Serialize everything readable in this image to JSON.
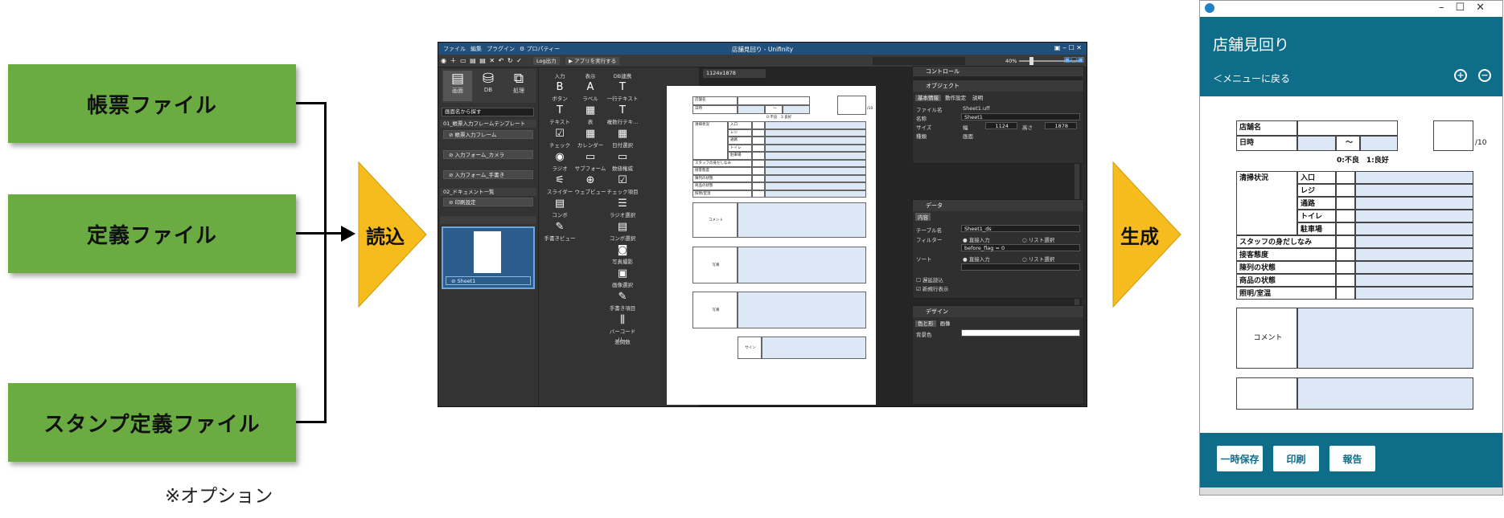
{
  "sources": [
    {
      "label": "帳票ファイル"
    },
    {
      "label": "定義ファイル"
    },
    {
      "label": "スタンプ定義ファイル"
    }
  ],
  "note": "※オプション",
  "arrows": {
    "read": "読込",
    "generate": "生成",
    "arrow_color": "#f6bc1e",
    "box_color": "#6aac42"
  },
  "editor": {
    "menu": [
      "ファイル",
      "編集",
      "プラグイン",
      "⚙ プロパティー"
    ],
    "title": "店舗見回り - Unifinity",
    "toolbar": {
      "log": "Log出力",
      "run": "▶ アプリを実行する",
      "zoom": "40%"
    },
    "nav_tabs": [
      "画面",
      "DB",
      "処理"
    ],
    "search_placeholder": "画面名から探す",
    "groups": [
      {
        "title": "01_帳票入力フレームテンプレート",
        "items": [
          "⊘ 帳票入力フレーム",
          "⊘ 入力フォーム_カメラ",
          "⊘ 入力フォーム_手書き"
        ]
      },
      {
        "title": "02_ドキュメント一覧",
        "items": [
          "⊘ 印刷設定"
        ]
      }
    ],
    "sheet_label": "⊘ Sheet1",
    "tool_columns": [
      {
        "title": "入力",
        "tools": [
          {
            "glyph": "B",
            "label": "ボタン"
          },
          {
            "glyph": "T",
            "label": "テキスト"
          },
          {
            "glyph": "☑",
            "label": "チェック"
          },
          {
            "glyph": "◉",
            "label": "ラジオ"
          },
          {
            "glyph": "⚟",
            "label": "スライダー"
          },
          {
            "glyph": "▤",
            "label": "コンボ"
          },
          {
            "glyph": "✎",
            "label": "手書きビュー"
          }
        ]
      },
      {
        "title": "表示",
        "tools": [
          {
            "glyph": "A",
            "label": "ラベル"
          },
          {
            "glyph": "▦",
            "label": "表"
          },
          {
            "glyph": "▦",
            "label": "カレンダー"
          },
          {
            "glyph": "▭",
            "label": "サブフォーム"
          },
          {
            "glyph": "⊕",
            "label": "ウェブビュー"
          }
        ]
      },
      {
        "title": "DB連携",
        "tools": [
          {
            "glyph": "T",
            "label": "一行テキスト"
          },
          {
            "glyph": "T",
            "label": "複数行テキ..."
          },
          {
            "glyph": "▦",
            "label": "日付選択"
          },
          {
            "glyph": "▭",
            "label": "数値権威"
          },
          {
            "glyph": "☑",
            "label": "チェック項目"
          },
          {
            "glyph": "☰",
            "label": "ラジオ選択"
          },
          {
            "glyph": "▤",
            "label": "コンボ選択"
          },
          {
            "glyph": "◙",
            "label": "写真撮影"
          },
          {
            "glyph": "▣",
            "label": "画像選択"
          },
          {
            "glyph": "✎",
            "label": "手書き項目"
          },
          {
            "glyph": "⫼",
            "label": "バーコードリ..."
          },
          {
            "glyph": "",
            "label": "差問数"
          }
        ]
      }
    ],
    "canvas_tab": "1124x1878",
    "paper": {
      "store": "店舗名",
      "date": "日時",
      "tilde": "〜",
      "legend": "0:不良　1:良好",
      "slash": "/10",
      "clean": "清掃状況",
      "areas": [
        "入口",
        "レジ",
        "通路",
        "トイレ",
        "駐車場"
      ],
      "rows": [
        "スタッフの身だしなみ",
        "接客態度",
        "陳列の状態",
        "商品の状態",
        "照明/室温"
      ],
      "comment": "コメント",
      "photo1": "写真",
      "photo2": "写真",
      "sign": "サイン"
    },
    "props": {
      "control": "コントロール",
      "object": "オブジェクト",
      "object_tabs": [
        "基本情報",
        "動作設定",
        "説明"
      ],
      "file_label": "ファイル名",
      "file_value": "Sheet1.uff",
      "name_label": "名称",
      "name_value": "Sheet1",
      "size_label": "サイズ",
      "width_label": "幅",
      "width_value": "1124",
      "height_label": "高さ",
      "height_value": "1878",
      "kind_label": "種類",
      "kind_value": "画面",
      "data": "データ",
      "data_tab": "内容",
      "table_label": "テーブル名",
      "table_value": "Sheet1_ds",
      "filter_label": "フィルター",
      "direct": "直接入力",
      "list": "リスト選択",
      "filter_value": "before_flag = 0",
      "sort_label": "ソート",
      "direct2": "直接入力",
      "list2": "リスト選択",
      "delay": "遅延読込",
      "newrow": "新規行表示",
      "design": "デザイン",
      "design_tabs": [
        "色と形",
        "画像"
      ],
      "bg_label": "背景色"
    }
  },
  "mobile": {
    "title": "店舗見回り",
    "back": "＜メニューに戻る",
    "store": "店舗名",
    "date": "日時",
    "tilde": "〜",
    "legend": "0:不良　1:良好",
    "slash": "/10",
    "clean": "清掃状況",
    "areas": [
      "入口",
      "レジ",
      "通路",
      "トイレ",
      "駐車場"
    ],
    "rows": [
      "スタッフの身だしなみ",
      "接客態度",
      "陳列の状態",
      "商品の状態",
      "照明/室温"
    ],
    "comment": "コメント",
    "buttons": [
      "一時保存",
      "印刷",
      "報告"
    ]
  }
}
